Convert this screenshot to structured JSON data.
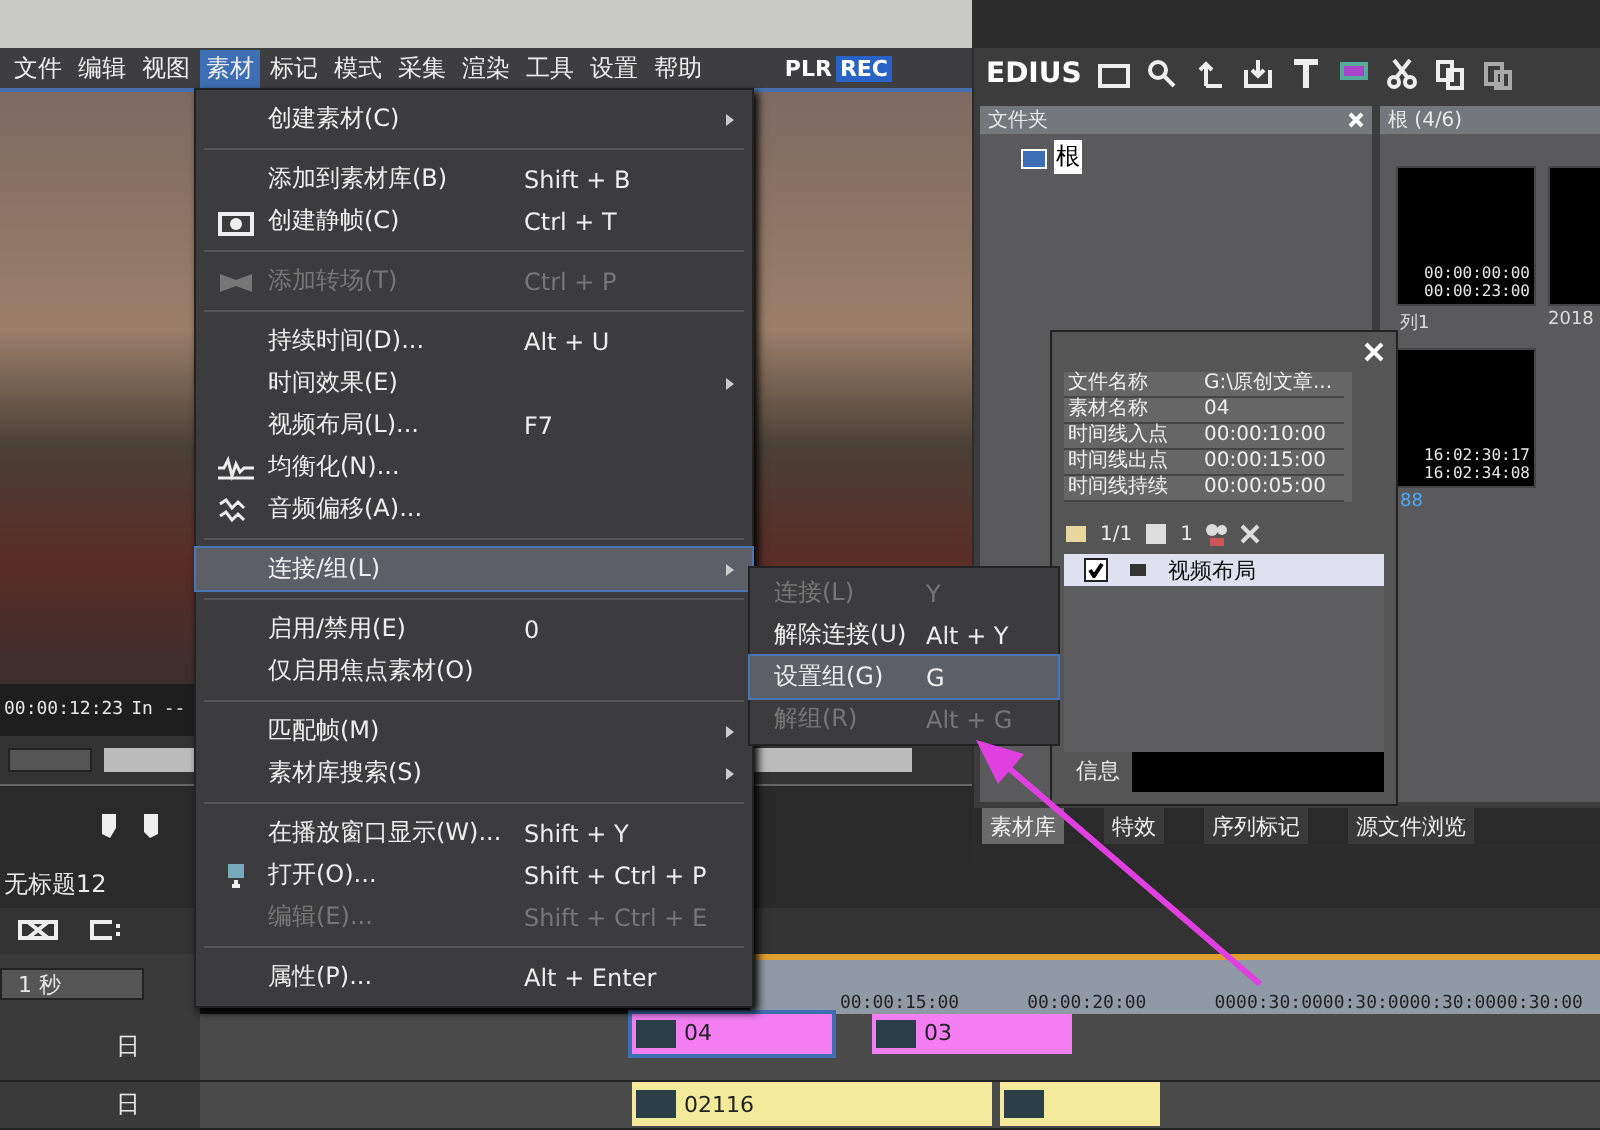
{
  "menubar": {
    "items": [
      {
        "label": "文件",
        "selected": false
      },
      {
        "label": "编辑",
        "selected": false
      },
      {
        "label": "视图",
        "selected": false
      },
      {
        "label": "素材",
        "selected": true
      },
      {
        "label": "标记",
        "selected": false
      },
      {
        "label": "模式",
        "selected": false
      },
      {
        "label": "采集",
        "selected": false
      },
      {
        "label": "渲染",
        "selected": false
      },
      {
        "label": "工具",
        "selected": false
      },
      {
        "label": "设置",
        "selected": false
      },
      {
        "label": "帮助",
        "selected": false
      }
    ],
    "mode_plr": "PLR",
    "mode_rec": "REC"
  },
  "player": {
    "timecode": "00:00:12:23",
    "in_point": "In --"
  },
  "menu": {
    "items": [
      {
        "kind": "item",
        "label": "创建素材(C)",
        "submenu": true,
        "disabled": false,
        "selected": false
      },
      {
        "kind": "separator"
      },
      {
        "kind": "item",
        "label": "添加到素材库(B)",
        "shortcut": "Shift + B",
        "submenu": false,
        "disabled": false,
        "selected": false
      },
      {
        "kind": "item",
        "label": "创建静帧(C)",
        "shortcut": "Ctrl + T",
        "submenu": false,
        "disabled": false,
        "selected": false
      },
      {
        "kind": "separator"
      },
      {
        "kind": "item",
        "label": "添加转场(T)",
        "shortcut": "Ctrl + P",
        "submenu": false,
        "disabled": true,
        "selected": false
      },
      {
        "kind": "separator"
      },
      {
        "kind": "item",
        "label": "持续时间(D)...",
        "shortcut": "Alt + U",
        "submenu": false,
        "disabled": false,
        "selected": false
      },
      {
        "kind": "item",
        "label": "时间效果(E)",
        "submenu": true,
        "disabled": false,
        "selected": false
      },
      {
        "kind": "item",
        "label": "视频布局(L)...",
        "shortcut": "F7",
        "submenu": false,
        "disabled": false,
        "selected": false
      },
      {
        "kind": "item",
        "label": "均衡化(N)...",
        "submenu": false,
        "disabled": false,
        "selected": false
      },
      {
        "kind": "item",
        "label": "音频偏移(A)...",
        "submenu": false,
        "disabled": false,
        "selected": false
      },
      {
        "kind": "separator"
      },
      {
        "kind": "item",
        "label": "连接/组(L)",
        "submenu": true,
        "disabled": false,
        "selected": true
      },
      {
        "kind": "separator"
      },
      {
        "kind": "item",
        "label": "启用/禁用(E)",
        "shortcut": "0",
        "submenu": false,
        "disabled": false,
        "selected": false
      },
      {
        "kind": "item",
        "label": "仅启用焦点素材(O)",
        "submenu": false,
        "disabled": false,
        "selected": false
      },
      {
        "kind": "separator"
      },
      {
        "kind": "item",
        "label": "匹配帧(M)",
        "submenu": true,
        "disabled": false,
        "selected": false
      },
      {
        "kind": "item",
        "label": "素材库搜索(S)",
        "submenu": true,
        "disabled": false,
        "selected": false
      },
      {
        "kind": "separator"
      },
      {
        "kind": "item",
        "label": "在播放窗口显示(W)...",
        "shortcut": "Shift + Y",
        "submenu": false,
        "disabled": false,
        "selected": false
      },
      {
        "kind": "item",
        "label": "打开(O)...",
        "shortcut": "Shift + Ctrl + P",
        "submenu": false,
        "disabled": false,
        "selected": false
      },
      {
        "kind": "item",
        "label": "编辑(E)...",
        "shortcut": "Shift + Ctrl + E",
        "submenu": false,
        "disabled": true,
        "selected": false
      },
      {
        "kind": "separator"
      },
      {
        "kind": "item",
        "label": "属性(P)...",
        "shortcut": "Alt + Enter",
        "submenu": false,
        "disabled": false,
        "selected": false
      }
    ]
  },
  "submenu": {
    "items": [
      {
        "label": "连接(L)",
        "shortcut": "Y",
        "disabled": true,
        "selected": false
      },
      {
        "label": "解除连接(U)",
        "shortcut": "Alt + Y",
        "disabled": false,
        "selected": false
      },
      {
        "label": "设置组(G)",
        "shortcut": "G",
        "disabled": false,
        "selected": true
      },
      {
        "label": "解组(R)",
        "shortcut": "Alt + G",
        "disabled": true,
        "selected": false
      }
    ]
  },
  "bin": {
    "title": "EDIUS",
    "folder_panel": {
      "title": "文件夹",
      "root": "根"
    },
    "clip_panel": {
      "title": "根 (4/6)"
    },
    "clips": [
      {
        "label": "列1",
        "tc_in": "00:00:00:00",
        "tc_out": "00:00:23:00"
      },
      {
        "label": "2018"
      },
      {
        "label": "88",
        "tc_in": "16:02:30:17",
        "tc_out": "16:02:34:08"
      }
    ],
    "tabs": [
      {
        "label": "素材库",
        "selected": true
      },
      {
        "label": "特效",
        "selected": false
      },
      {
        "label": "序列标记",
        "selected": false
      },
      {
        "label": "源文件浏览",
        "selected": false
      }
    ]
  },
  "info": {
    "rows": [
      {
        "name": "文件名称",
        "value": "G:\\原创文章..."
      },
      {
        "name": "素材名称",
        "value": "04"
      },
      {
        "name": "时间线入点",
        "value": "00:00:10:00"
      },
      {
        "name": "时间线出点",
        "value": "00:00:15:00"
      },
      {
        "name": "时间线持续",
        "value": "00:00:05:00"
      }
    ],
    "clip_count": "1/1",
    "filter_count": "1",
    "effects": [
      {
        "label": "视频布局",
        "checked": true,
        "selected": true
      }
    ],
    "footer": "信息"
  },
  "timeline": {
    "title": "无标题12",
    "scale": "1 秒",
    "ruler": [
      "00:00:15:00",
      "00:00:20:00",
      "0000:30:0000:30:0000:30:0000:30:00"
    ],
    "tracks": [
      {
        "label": "日",
        "clips": [
          {
            "name": "04",
            "kind": "video",
            "selected": true
          },
          {
            "name": "03",
            "kind": "video",
            "selected": false
          }
        ]
      },
      {
        "label": "日",
        "clips": [
          {
            "name": "02116",
            "kind": "audio",
            "selected": false
          },
          {
            "kind": "audio",
            "selected": false
          }
        ]
      }
    ]
  }
}
